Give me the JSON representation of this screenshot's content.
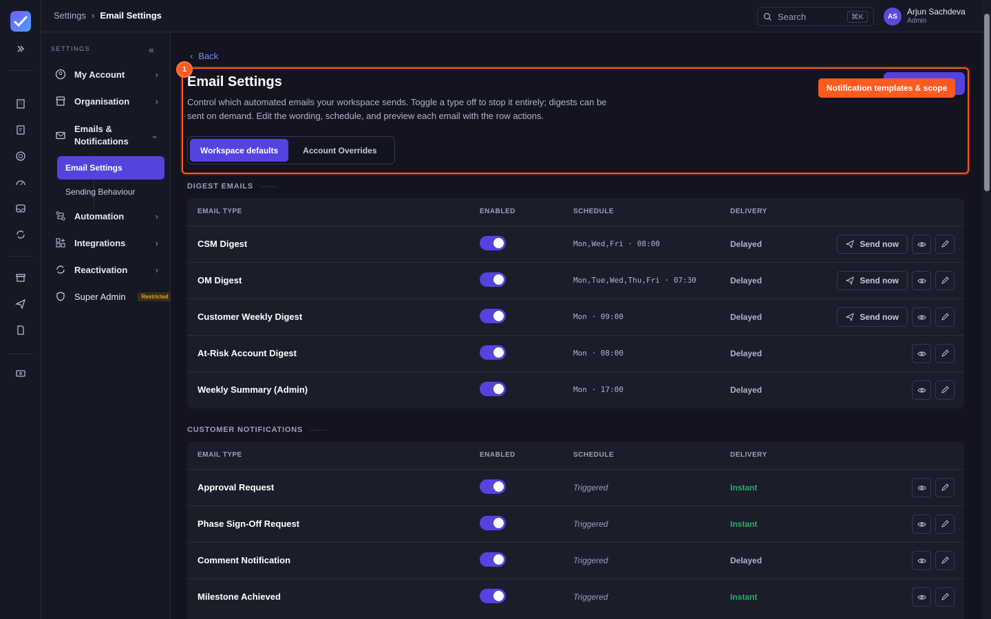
{
  "topbar": {
    "crumb_parent": "Settings",
    "crumb_current": "Email Settings",
    "search_placeholder": "Search",
    "search_kbd": "⌘K",
    "avatar_initials": "AS",
    "user_name": "Arjun Sachdeva",
    "user_role": "Admin"
  },
  "sidebar": {
    "heading": "SETTINGS",
    "items": [
      {
        "label": "My Account"
      },
      {
        "label": "Organisation"
      },
      {
        "label": "Emails & Notifications"
      },
      {
        "label": "Automation"
      },
      {
        "label": "Integrations"
      },
      {
        "label": "Reactivation"
      },
      {
        "label": "Super Admin",
        "badge": "Restricted"
      }
    ],
    "sub_items": [
      {
        "label": "Email Settings"
      },
      {
        "label": "Sending Behaviour"
      }
    ]
  },
  "page": {
    "back_label": "Back",
    "title": "Email Settings",
    "description": "Control which automated emails your workspace sends. Toggle a type off to stop it entirely; digests can be sent on demand. Edit the wording, schedule, and preview each email with the row actions.",
    "tabs": [
      {
        "label": "Workspace defaults"
      },
      {
        "label": "Account Overrides"
      }
    ],
    "annotation_number": "1",
    "annotation_label": "Notification templates & scope"
  },
  "columns": {
    "type": "EMAIL TYPE",
    "enabled": "ENABLED",
    "schedule": "SCHEDULE",
    "delivery": "DELIVERY"
  },
  "send_label": "Send now",
  "digest": {
    "heading": "DIGEST EMAILS",
    "rows": [
      {
        "name": "CSM Digest",
        "schedule": "Mon,Wed,Fri · 08:00",
        "delivery": "Delayed"
      },
      {
        "name": "OM Digest",
        "schedule": "Mon,Tue,Wed,Thu,Fri · 07:30",
        "delivery": "Delayed"
      },
      {
        "name": "Customer Weekly Digest",
        "schedule": "Mon · 09:00",
        "delivery": "Delayed"
      },
      {
        "name": "At-Risk Account Digest",
        "schedule": "Mon · 08:00",
        "delivery": "Delayed"
      },
      {
        "name": "Weekly Summary (Admin)",
        "schedule": "Mon · 17:00",
        "delivery": "Delayed"
      }
    ]
  },
  "customer": {
    "heading": "CUSTOMER NOTIFICATIONS",
    "rows": [
      {
        "name": "Approval Request",
        "schedule": "Triggered",
        "delivery": "Instant"
      },
      {
        "name": "Phase Sign-Off Request",
        "schedule": "Triggered",
        "delivery": "Instant"
      },
      {
        "name": "Comment Notification",
        "schedule": "Triggered",
        "delivery": "Delayed"
      },
      {
        "name": "Milestone Achieved",
        "schedule": "Triggered",
        "delivery": "Instant"
      }
    ]
  },
  "colors": {
    "accent": "#5543e0",
    "highlight": "#ff5a1f",
    "instant": "#2fae62"
  }
}
